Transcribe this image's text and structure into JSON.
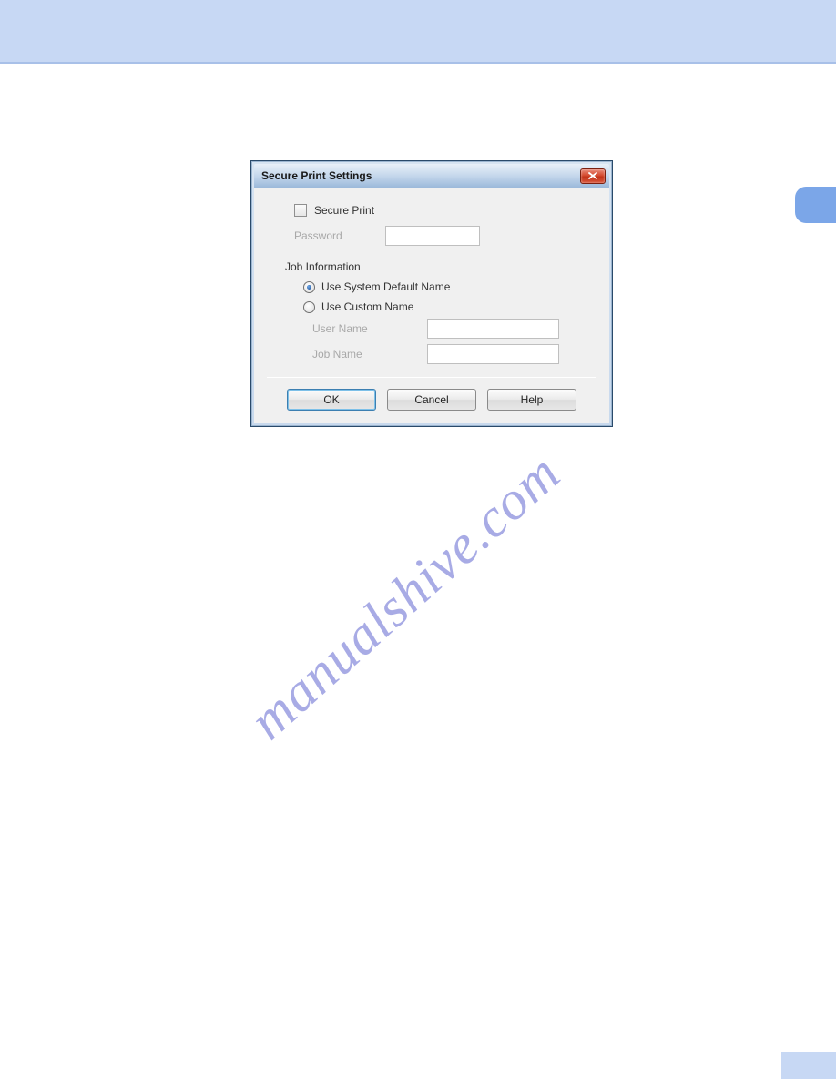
{
  "watermark": "manualshive.com",
  "dialog": {
    "title": "Secure Print Settings",
    "secure_print_label": "Secure Print",
    "password_label": "Password",
    "password_value": "",
    "job_info_label": "Job Information",
    "radio_default_label": "Use System Default Name",
    "radio_custom_label": "Use Custom Name",
    "user_name_label": "User Name",
    "user_name_value": "",
    "job_name_label": "Job Name",
    "job_name_value": "",
    "buttons": {
      "ok": "OK",
      "cancel": "Cancel",
      "help": "Help"
    }
  }
}
